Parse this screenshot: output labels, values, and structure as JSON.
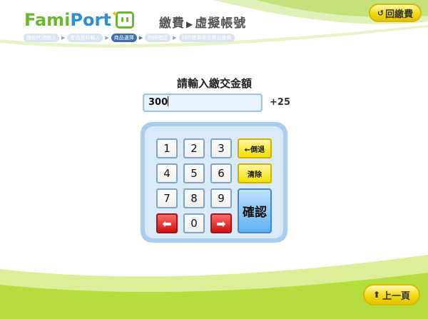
{
  "header": {
    "logo_text_a": "Fami",
    "logo_text_b": "Port",
    "title_a": "繳費",
    "title_arrow": "▶",
    "title_b": "虛擬帳號",
    "home_button": "回繳費"
  },
  "breadcrumb": {
    "steps": [
      "繳款代號輸入",
      "會員資料輸入",
      "商品選擇",
      "明細確認",
      "列印繳費單至櫃台繳費"
    ],
    "active_index": 2
  },
  "main": {
    "prompt": "請輸入繳交金額",
    "amount_value": "300",
    "fee": "+25"
  },
  "keypad": {
    "digits": [
      "1",
      "2",
      "3",
      "4",
      "5",
      "6",
      "7",
      "8",
      "9",
      "0"
    ],
    "left_arrow": "⬅",
    "right_arrow": "➡",
    "backspace": "←倒退",
    "clear": "清除",
    "confirm": "確認"
  },
  "footer": {
    "prev_button": "上一頁"
  },
  "colors": {
    "brand_green": "#6ab82e",
    "brand_blue": "#2a8fd6",
    "button_yellow": "#f4d90f",
    "keypad_blue": "#a8cdee",
    "confirm_blue": "#5fb2f2",
    "arrow_red": "#d21010"
  }
}
